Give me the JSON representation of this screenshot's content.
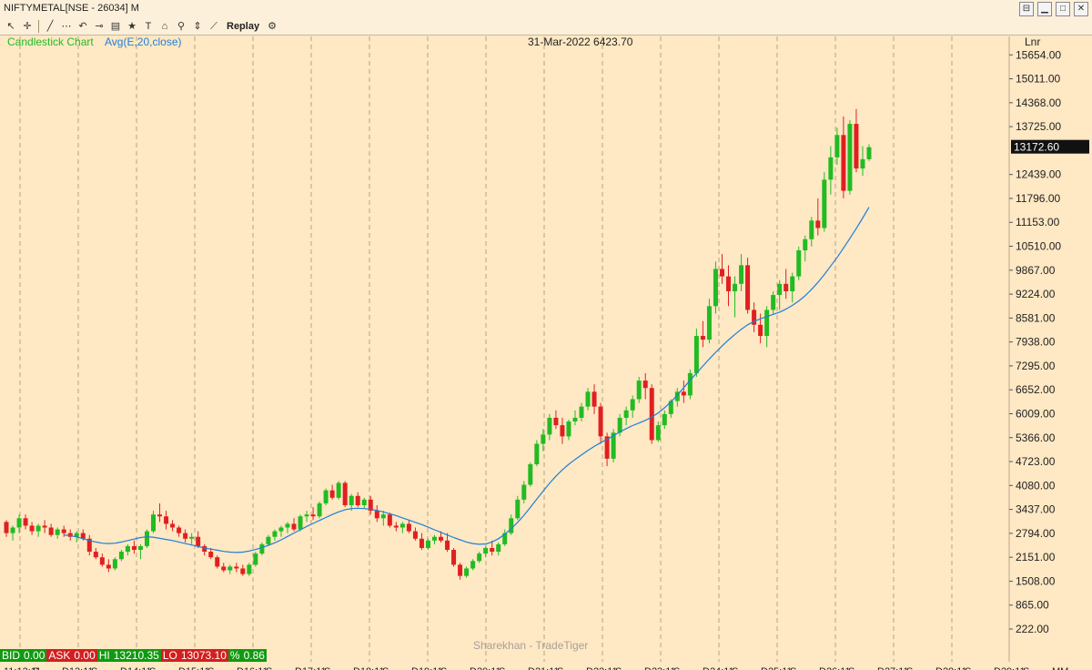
{
  "window": {
    "title": "NIFTYMETAL[NSE - 26034] M",
    "controls": [
      "restore-icon",
      "minimize-icon",
      "maximize-icon",
      "close-icon"
    ]
  },
  "toolbar": {
    "icons": [
      "cursor-icon",
      "crosshair-icon",
      "line-tool-icon",
      "pattern-icon",
      "undo-icon",
      "link-icon",
      "data-window-icon",
      "star-icon",
      "text-icon",
      "magnet-icon",
      "zoom-icon",
      "scale-icon",
      "indicator-icon"
    ],
    "replay_label": "Replay",
    "settings_icon": "gear-icon"
  },
  "chart_header": {
    "chart_type_label": "Candlestick Chart",
    "indicator_label": "Avg(E,20,close)",
    "hover_info": "31-Mar-2022 6423.70",
    "scale_label": "Lnr",
    "watermark": "Sharekhan - TradeTiger",
    "last_price_tag": "13172.60"
  },
  "status": {
    "bid_label": "BID",
    "bid_value": "0.00",
    "ask_label": "ASK",
    "ask_value": "0.00",
    "hi_label": "HI",
    "hi_value": "13210.35",
    "lo_label": "LO",
    "lo_value": "13073.10",
    "pct_label": "%",
    "pct_value": "0.86"
  },
  "x_axis_labels": [
    "11:12:11",
    "S",
    "D13:11",
    "S",
    "D14:11",
    "S",
    "D15:11",
    "S",
    "D16:11",
    "S",
    "D17:11",
    "S",
    "D18:11",
    "S",
    "D19:11",
    "S",
    "D20:11",
    "S",
    "D21:11",
    "S",
    "D22:11",
    "S",
    "D23:11",
    "S",
    "D24:11",
    "S",
    "D25:11",
    "S",
    "D26:11",
    "S",
    "D27:11",
    "S",
    "D28:11",
    "S",
    "D29:11",
    "S",
    "MM"
  ],
  "colors": {
    "bull": "#22bb22",
    "bear": "#e02020",
    "ema": "#1e7fd6",
    "background": "#ffe8c4"
  },
  "chart_data": {
    "type": "candlestick",
    "symbol": "NIFTYMETAL",
    "interval": "Monthly",
    "scale": "linear",
    "ylim": [
      0,
      16000
    ],
    "y_ticks": [
      222.0,
      865.0,
      1508.0,
      2151.0,
      2794.0,
      3437.0,
      4080.0,
      4723.0,
      5366.0,
      6009.0,
      6652.0,
      7295.0,
      7938.0,
      8581.0,
      9224.0,
      9867.0,
      10510.0,
      11153.0,
      11796.0,
      12439.0,
      13172.6,
      13725.0,
      14368.0,
      15011.0,
      15654.0
    ],
    "y_tick_labels": [
      "222.00",
      "865.00",
      "1508.00",
      "2151.00",
      "2794.00",
      "3437.00",
      "4080.00",
      "4723.00",
      "5366.00",
      "6009.00",
      "6652.00",
      "7295.00",
      "7938.00",
      "8581.00",
      "9224.00",
      "9867.00",
      "10510.00",
      "11153.00",
      "11796.00",
      "12439.00",
      "13725.00",
      "14368.00",
      "15011.00",
      "15654.00"
    ],
    "candles": [
      [
        3100,
        3150,
        2700,
        2800
      ],
      [
        2800,
        3000,
        2600,
        2950
      ],
      [
        2950,
        3300,
        2800,
        3200
      ],
      [
        3200,
        3300,
        2900,
        3000
      ],
      [
        3000,
        3100,
        2750,
        2850
      ],
      [
        2850,
        3050,
        2700,
        3000
      ],
      [
        3000,
        3150,
        2800,
        2950
      ],
      [
        2950,
        3050,
        2700,
        2750
      ],
      [
        2750,
        2950,
        2650,
        2900
      ],
      [
        2900,
        3000,
        2700,
        2800
      ],
      [
        2800,
        2900,
        2600,
        2700
      ],
      [
        2700,
        2850,
        2550,
        2800
      ],
      [
        2800,
        2900,
        2600,
        2650
      ],
      [
        2650,
        2750,
        2200,
        2300
      ],
      [
        2300,
        2400,
        2100,
        2150
      ],
      [
        2150,
        2250,
        1900,
        1950
      ],
      [
        1950,
        2100,
        1750,
        1850
      ],
      [
        1850,
        2150,
        1800,
        2100
      ],
      [
        2100,
        2350,
        2050,
        2300
      ],
      [
        2300,
        2500,
        2200,
        2450
      ],
      [
        2450,
        2600,
        2250,
        2350
      ],
      [
        2350,
        2500,
        2100,
        2450
      ],
      [
        2450,
        2900,
        2400,
        2850
      ],
      [
        2850,
        3400,
        2800,
        3300
      ],
      [
        3300,
        3600,
        3100,
        3250
      ],
      [
        3250,
        3400,
        2900,
        3050
      ],
      [
        3050,
        3150,
        2850,
        2950
      ],
      [
        2950,
        3000,
        2700,
        2800
      ],
      [
        2800,
        2900,
        2550,
        2650
      ],
      [
        2650,
        2800,
        2500,
        2700
      ],
      [
        2700,
        2850,
        2400,
        2450
      ],
      [
        2450,
        2500,
        2200,
        2300
      ],
      [
        2300,
        2400,
        2100,
        2150
      ],
      [
        2150,
        2200,
        1850,
        1900
      ],
      [
        1900,
        2000,
        1750,
        1800
      ],
      [
        1800,
        1950,
        1700,
        1900
      ],
      [
        1900,
        2000,
        1750,
        1850
      ],
      [
        1850,
        1950,
        1650,
        1700
      ],
      [
        1700,
        2000,
        1650,
        1950
      ],
      [
        1950,
        2300,
        1900,
        2250
      ],
      [
        2250,
        2550,
        2200,
        2500
      ],
      [
        2500,
        2750,
        2450,
        2700
      ],
      [
        2700,
        2900,
        2600,
        2850
      ],
      [
        2850,
        3000,
        2700,
        2950
      ],
      [
        2950,
        3100,
        2800,
        3050
      ],
      [
        3050,
        3200,
        2850,
        2900
      ],
      [
        2900,
        3300,
        2850,
        3250
      ],
      [
        3250,
        3400,
        3100,
        3300
      ],
      [
        3300,
        3500,
        3150,
        3250
      ],
      [
        3250,
        3650,
        3200,
        3600
      ],
      [
        3600,
        4000,
        3550,
        3950
      ],
      [
        3950,
        4100,
        3700,
        3750
      ],
      [
        3750,
        4200,
        3700,
        4150
      ],
      [
        4150,
        4200,
        3500,
        3550
      ],
      [
        3550,
        3850,
        3400,
        3800
      ],
      [
        3800,
        3900,
        3500,
        3550
      ],
      [
        3550,
        3750,
        3450,
        3700
      ],
      [
        3700,
        3800,
        3300,
        3400
      ],
      [
        3400,
        3550,
        3100,
        3200
      ],
      [
        3200,
        3400,
        3000,
        3300
      ],
      [
        3300,
        3350,
        2950,
        3000
      ],
      [
        3000,
        3100,
        2850,
        2950
      ],
      [
        2950,
        3100,
        2800,
        3050
      ],
      [
        3050,
        3150,
        2800,
        2850
      ],
      [
        2850,
        2950,
        2600,
        2650
      ],
      [
        2650,
        2800,
        2350,
        2400
      ],
      [
        2400,
        2650,
        2350,
        2600
      ],
      [
        2600,
        2750,
        2500,
        2700
      ],
      [
        2700,
        2850,
        2550,
        2600
      ],
      [
        2600,
        2800,
        2300,
        2350
      ],
      [
        2350,
        2400,
        1900,
        1950
      ],
      [
        1950,
        2000,
        1550,
        1650
      ],
      [
        1650,
        1900,
        1600,
        1850
      ],
      [
        1850,
        2100,
        1800,
        2050
      ],
      [
        2050,
        2300,
        2000,
        2250
      ],
      [
        2250,
        2450,
        2150,
        2400
      ],
      [
        2400,
        2600,
        2200,
        2300
      ],
      [
        2300,
        2550,
        2200,
        2500
      ],
      [
        2500,
        2900,
        2450,
        2800
      ],
      [
        2800,
        3300,
        2750,
        3200
      ],
      [
        3200,
        3800,
        3150,
        3700
      ],
      [
        3700,
        4200,
        3600,
        4100
      ],
      [
        4100,
        4700,
        4050,
        4650
      ],
      [
        4650,
        5300,
        4600,
        5200
      ],
      [
        5200,
        5600,
        5000,
        5450
      ],
      [
        5450,
        6000,
        5300,
        5900
      ],
      [
        5900,
        6100,
        5600,
        5700
      ],
      [
        5700,
        5900,
        5200,
        5400
      ],
      [
        5400,
        5850,
        5300,
        5800
      ],
      [
        5800,
        6100,
        5700,
        5900
      ],
      [
        5900,
        6300,
        5800,
        6200
      ],
      [
        6200,
        6700,
        6100,
        6600
      ],
      [
        6600,
        6800,
        6000,
        6200
      ],
      [
        6200,
        6300,
        5200,
        5400
      ],
      [
        5400,
        5500,
        4600,
        4800
      ],
      [
        4800,
        5600,
        4700,
        5500
      ],
      [
        5500,
        6000,
        5400,
        5900
      ],
      [
        5900,
        6200,
        5700,
        6100
      ],
      [
        6100,
        6500,
        5900,
        6400
      ],
      [
        6400,
        7000,
        6300,
        6900
      ],
      [
        6900,
        7100,
        6400,
        6700
      ],
      [
        6700,
        6800,
        5200,
        5300
      ],
      [
        5300,
        5800,
        5250,
        5700
      ],
      [
        5700,
        6100,
        5600,
        6000
      ],
      [
        6000,
        6400,
        5900,
        6350
      ],
      [
        6350,
        6700,
        6200,
        6600
      ],
      [
        6600,
        6900,
        6300,
        6500
      ],
      [
        6500,
        7200,
        6400,
        7100
      ],
      [
        7100,
        8300,
        7000,
        8100
      ],
      [
        8100,
        8500,
        7800,
        8000
      ],
      [
        8000,
        9100,
        7900,
        8900
      ],
      [
        8900,
        10100,
        8700,
        9900
      ],
      [
        9900,
        10300,
        9500,
        9700
      ],
      [
        9700,
        10000,
        8900,
        9300
      ],
      [
        9300,
        9700,
        8600,
        9500
      ],
      [
        9500,
        10300,
        9300,
        10000
      ],
      [
        10000,
        10200,
        8700,
        8800
      ],
      [
        8800,
        9000,
        8200,
        8400
      ],
      [
        8400,
        8700,
        7900,
        8100
      ],
      [
        8100,
        8900,
        7800,
        8800
      ],
      [
        8800,
        9300,
        8700,
        9200
      ],
      [
        9200,
        9600,
        8800,
        9500
      ],
      [
        9500,
        9900,
        9100,
        9300
      ],
      [
        9300,
        9800,
        9000,
        9700
      ],
      [
        9700,
        10500,
        9600,
        10400
      ],
      [
        10400,
        10800,
        10100,
        10700
      ],
      [
        10700,
        11300,
        10500,
        11200
      ],
      [
        11200,
        11800,
        10800,
        11000
      ],
      [
        11000,
        12500,
        10900,
        12300
      ],
      [
        12300,
        13200,
        11900,
        12900
      ],
      [
        12900,
        13700,
        12700,
        13500
      ],
      [
        13500,
        14000,
        11800,
        12000
      ],
      [
        12000,
        13900,
        11900,
        13800
      ],
      [
        13800,
        14200,
        12500,
        12600
      ],
      [
        12600,
        13200,
        12400,
        12850
      ],
      [
        12850,
        13250,
        12800,
        13172.6
      ]
    ],
    "ema20": [
      2750,
      2730,
      2700,
      2650,
      2600,
      2560,
      2530,
      2520,
      2530,
      2560,
      2600,
      2640,
      2680,
      2700,
      2690,
      2660,
      2630,
      2600,
      2560,
      2520,
      2480,
      2440,
      2400,
      2370,
      2340,
      2310,
      2290,
      2280,
      2290,
      2320,
      2360,
      2410,
      2470,
      2540,
      2620,
      2710,
      2800,
      2890,
      2980,
      3060,
      3140,
      3220,
      3300,
      3370,
      3430,
      3460,
      3470,
      3460,
      3440,
      3410,
      3370,
      3320,
      3270,
      3210,
      3150,
      3090,
      3030,
      2960,
      2890,
      2820,
      2750,
      2680,
      2620,
      2560,
      2520,
      2500,
      2510,
      2560,
      2650,
      2770,
      2920,
      3090,
      3280,
      3490,
      3710,
      3930,
      4140,
      4330,
      4500,
      4650,
      4780,
      4900,
      5020,
      5130,
      5230,
      5320,
      5420,
      5520,
      5610,
      5690,
      5760,
      5830,
      5920,
      6030,
      6170,
      6330,
      6510,
      6710,
      6910,
      7100,
      7290,
      7480,
      7660,
      7830,
      7990,
      8140,
      8280,
      8400,
      8490,
      8560,
      8620,
      8680,
      8740,
      8820,
      8920,
      9040,
      9180,
      9350,
      9540,
      9750,
      9980,
      10210,
      10460,
      10720,
      10990,
      11270,
      11560
    ]
  }
}
